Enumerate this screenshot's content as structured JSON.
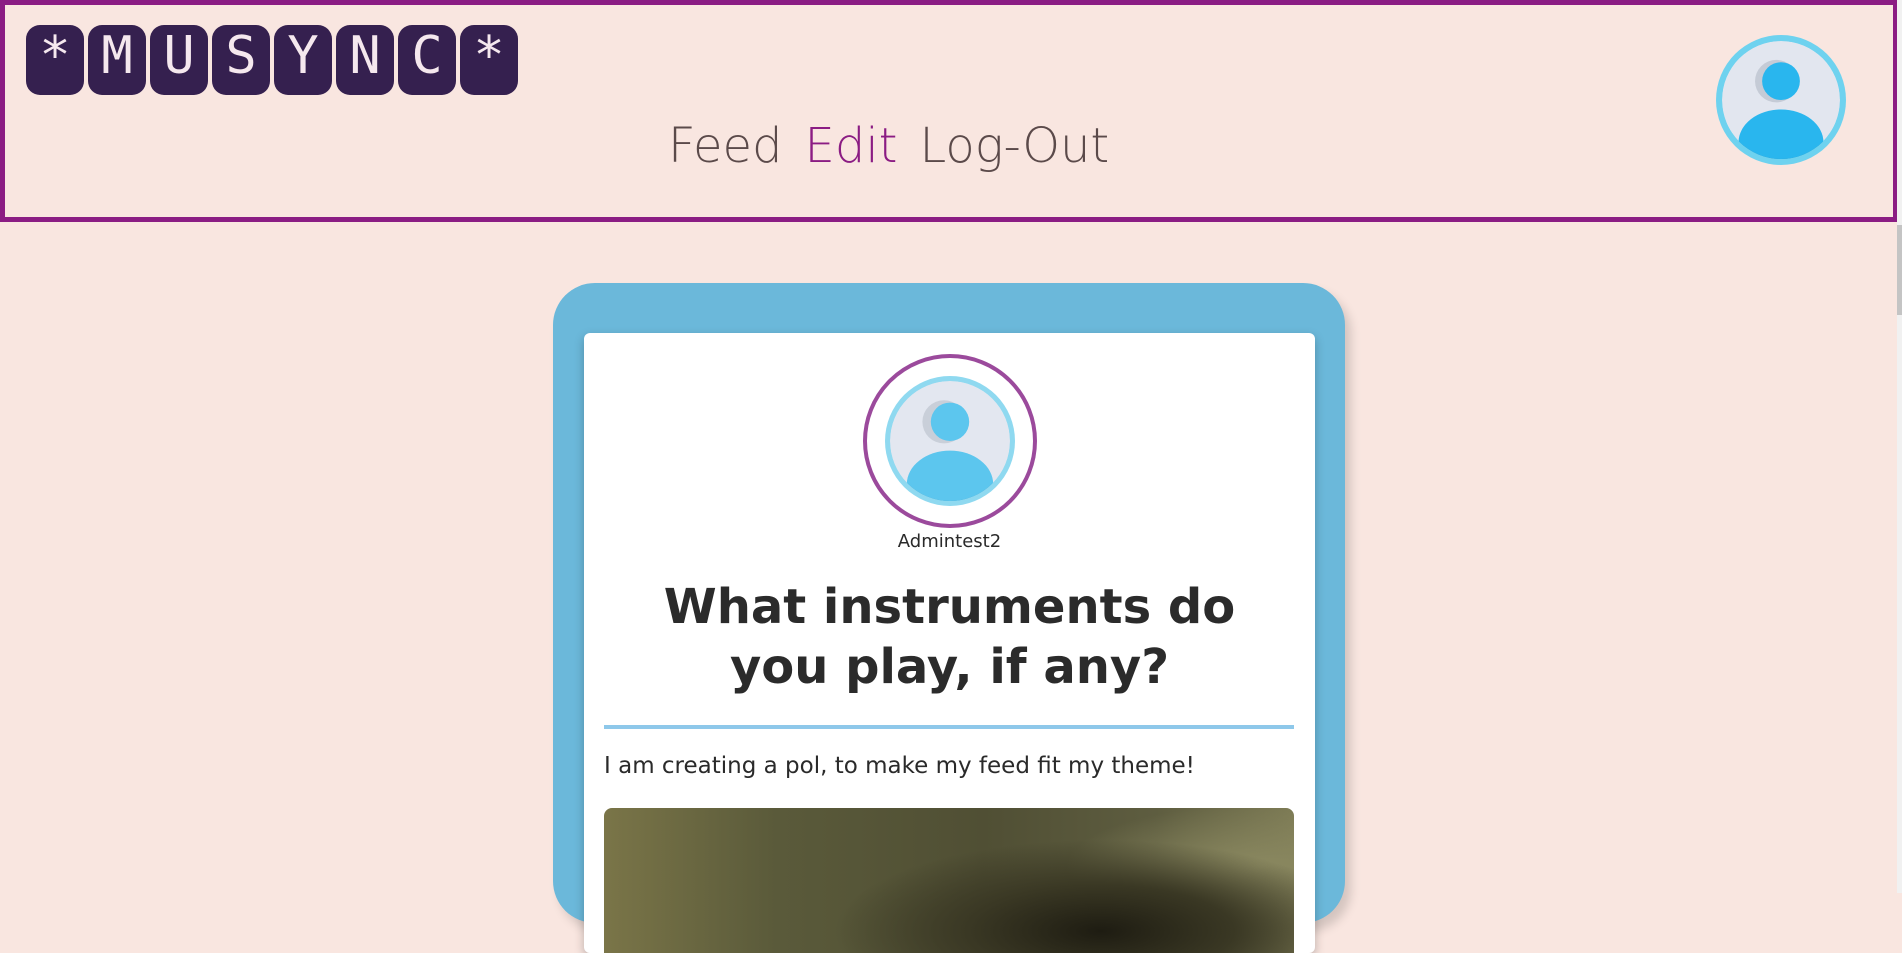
{
  "header": {
    "logo_letters": [
      "*",
      "M",
      "U",
      "S",
      "Y",
      "N",
      "C",
      "*"
    ],
    "nav": {
      "feed": "Feed",
      "edit": "Edit",
      "logout": "Log-Out"
    },
    "profile_icon": "user-avatar-icon"
  },
  "post": {
    "author": "Admintest2",
    "author_icon": "user-avatar-icon",
    "title": "What instruments do you play, if any?",
    "body": "I am creating a pol, to make my feed fit my theme!"
  },
  "colors": {
    "background": "#f9e6e0",
    "header_border": "#8b1c83",
    "nav_active": "#8b1c83",
    "logo_tile": "#35204f",
    "card_frame": "#6bb8da",
    "avatar_ring": "#9b4a9c",
    "divider": "#8ec8ea"
  }
}
